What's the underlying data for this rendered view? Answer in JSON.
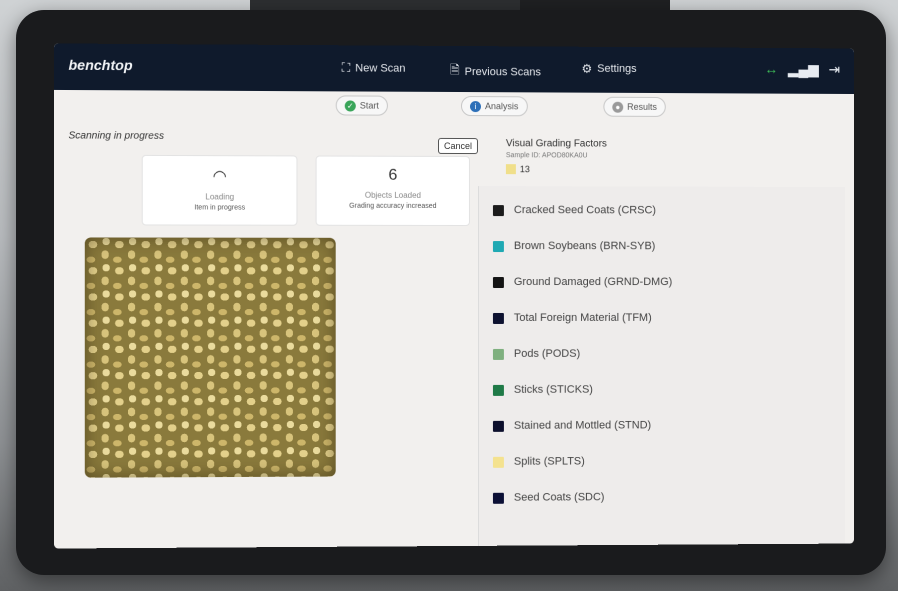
{
  "app": {
    "brand": "benchtop",
    "nav": {
      "new_scan": "New Scan",
      "previous_scans": "Previous Scans",
      "settings": "Settings"
    }
  },
  "steps": [
    {
      "label": "Start",
      "color": "#3aa55a"
    },
    {
      "label": "Analysis",
      "color": "#2c6fb8"
    },
    {
      "label": "Results",
      "color": "#9a9a9a"
    }
  ],
  "scan": {
    "title": "Scanning in progress",
    "cancel_label": "Cancel",
    "card_left": {
      "label": "Loading",
      "sub": "Item in progress"
    },
    "card_right": {
      "value": "6",
      "label": "Objects Loaded",
      "sub": "Grading accuracy increased"
    }
  },
  "grading": {
    "title": "Visual Grading Factors",
    "sample_id": "Sample ID: APOD80KA0U",
    "legend_count": "13",
    "factors": [
      {
        "label": "Cracked Seed Coats (CRSC)",
        "color": "#1b1b1b"
      },
      {
        "label": "Brown Soybeans (BRN-SYB)",
        "color": "#1fa9b3"
      },
      {
        "label": "Ground Damaged (GRND-DMG)",
        "color": "#141414"
      },
      {
        "label": "Total Foreign Material (TFM)",
        "color": "#0d1230"
      },
      {
        "label": "Pods (PODS)",
        "color": "#7fb07f"
      },
      {
        "label": "Sticks (STICKS)",
        "color": "#1f7a47"
      },
      {
        "label": "Stained and Mottled (STND)",
        "color": "#0c0f2c"
      },
      {
        "label": "Splits (SPLTS)",
        "color": "#f4e28f"
      },
      {
        "label": "Seed Coats (SDC)",
        "color": "#0b0f35"
      }
    ]
  }
}
